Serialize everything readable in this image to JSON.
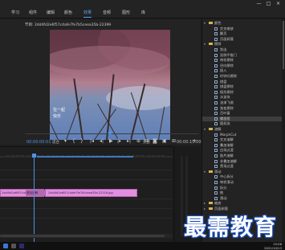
{
  "menu": {
    "items": [
      "学习",
      "组件",
      "编辑",
      "颜色",
      "效果",
      "音频",
      "图形",
      "库"
    ],
    "active_index": 4,
    "window_controls": [
      "—",
      "□",
      "×"
    ]
  },
  "monitor": {
    "title": "节目: 2dd4fd2e6f57c4afe7fe7b5ceea35b-22399",
    "caption_lines": [
      "在一起",
      "快乐"
    ],
    "timecode_current": "00:00:00:01",
    "fit_label": "适合",
    "quality_label": "完整",
    "timecode_end": "00:00:15:00"
  },
  "transport": {
    "buttons": [
      "▾",
      "{",
      "}",
      "|◂",
      "◂|",
      "▶",
      "|▸",
      "▸|",
      "⊕",
      "⊟",
      "◙",
      "▣",
      "⊞",
      "+"
    ]
  },
  "timeline": {
    "ruler_labels": [
      "00:00:00:00",
      "00:00:02:00",
      "00:00:04:00",
      "00:00:06:00",
      "00:00:08:00",
      "00:00:10:00",
      "00:00:12:00",
      "00:00:14:00"
    ],
    "clip1_label": "2dd4fd2e6f57c4afe7fe7b5ceea35b-22399.jpg",
    "clip1b_label": "叠加溶解",
    "clip2_label": "2dd4fd2e6f57c4afe7fe7b5ceea35b-22316.jpg"
  },
  "effects": {
    "rows": [
      {
        "label": "颜色",
        "level": 0,
        "kind": "folder",
        "open": true
      },
      {
        "label": "交叉缩放",
        "level": 1,
        "kind": "preset"
      },
      {
        "label": "翻页",
        "level": 1,
        "kind": "preset"
      },
      {
        "label": "页面剥落",
        "level": 1,
        "kind": "preset"
      },
      {
        "label": "擦除",
        "level": 0,
        "kind": "folder",
        "open": true
      },
      {
        "label": "划出",
        "level": 1,
        "kind": "preset"
      },
      {
        "label": "双侧平推门",
        "level": 1,
        "kind": "preset"
      },
      {
        "label": "带状擦除",
        "level": 1,
        "kind": "preset"
      },
      {
        "label": "径向擦除",
        "level": 1,
        "kind": "preset"
      },
      {
        "label": "插入",
        "level": 1,
        "kind": "preset"
      },
      {
        "label": "时钟式擦除",
        "level": 1,
        "kind": "preset"
      },
      {
        "label": "棋盘",
        "level": 1,
        "kind": "preset"
      },
      {
        "label": "棋盘擦除",
        "level": 1,
        "kind": "preset"
      },
      {
        "label": "楔形擦除",
        "level": 1,
        "kind": "preset"
      },
      {
        "label": "水波块",
        "level": 1,
        "kind": "preset"
      },
      {
        "label": "油漆飞溅",
        "level": 1,
        "kind": "preset"
      },
      {
        "label": "渐变擦除",
        "level": 1,
        "kind": "preset"
      },
      {
        "label": "百叶窗",
        "level": 1,
        "kind": "preset"
      },
      {
        "label": "螺旋框",
        "level": 1,
        "kind": "preset",
        "selected": true
      },
      {
        "label": "随机块",
        "level": 1,
        "kind": "preset"
      },
      {
        "label": "溶解",
        "level": 0,
        "kind": "folder",
        "open": true
      },
      {
        "label": "MorphCut",
        "level": 1,
        "kind": "preset"
      },
      {
        "label": "交叉溶解",
        "level": 1,
        "kind": "preset"
      },
      {
        "label": "叠加溶解",
        "level": 1,
        "kind": "preset"
      },
      {
        "label": "白场过渡",
        "level": 1,
        "kind": "preset"
      },
      {
        "label": "胶片溶解",
        "level": 1,
        "kind": "preset"
      },
      {
        "label": "非叠加溶解",
        "level": 1,
        "kind": "preset"
      },
      {
        "label": "黑场过渡",
        "level": 1,
        "kind": "preset"
      },
      {
        "label": "滑动",
        "level": 0,
        "kind": "folder",
        "open": true
      },
      {
        "label": "中心拆分",
        "level": 1,
        "kind": "preset"
      },
      {
        "label": "带状滑动",
        "level": 1,
        "kind": "preset"
      },
      {
        "label": "拆分",
        "level": 1,
        "kind": "preset"
      },
      {
        "label": "推",
        "level": 1,
        "kind": "preset"
      },
      {
        "label": "滑动",
        "level": 1,
        "kind": "preset"
      },
      {
        "label": "缩放",
        "level": 0,
        "kind": "folder",
        "open": false
      },
      {
        "label": "页面剥落",
        "level": 0,
        "kind": "folder",
        "open": false
      }
    ]
  },
  "taskbar": {
    "time": "15:06",
    "date": "2021/10/13"
  },
  "watermark": "最需教育"
}
